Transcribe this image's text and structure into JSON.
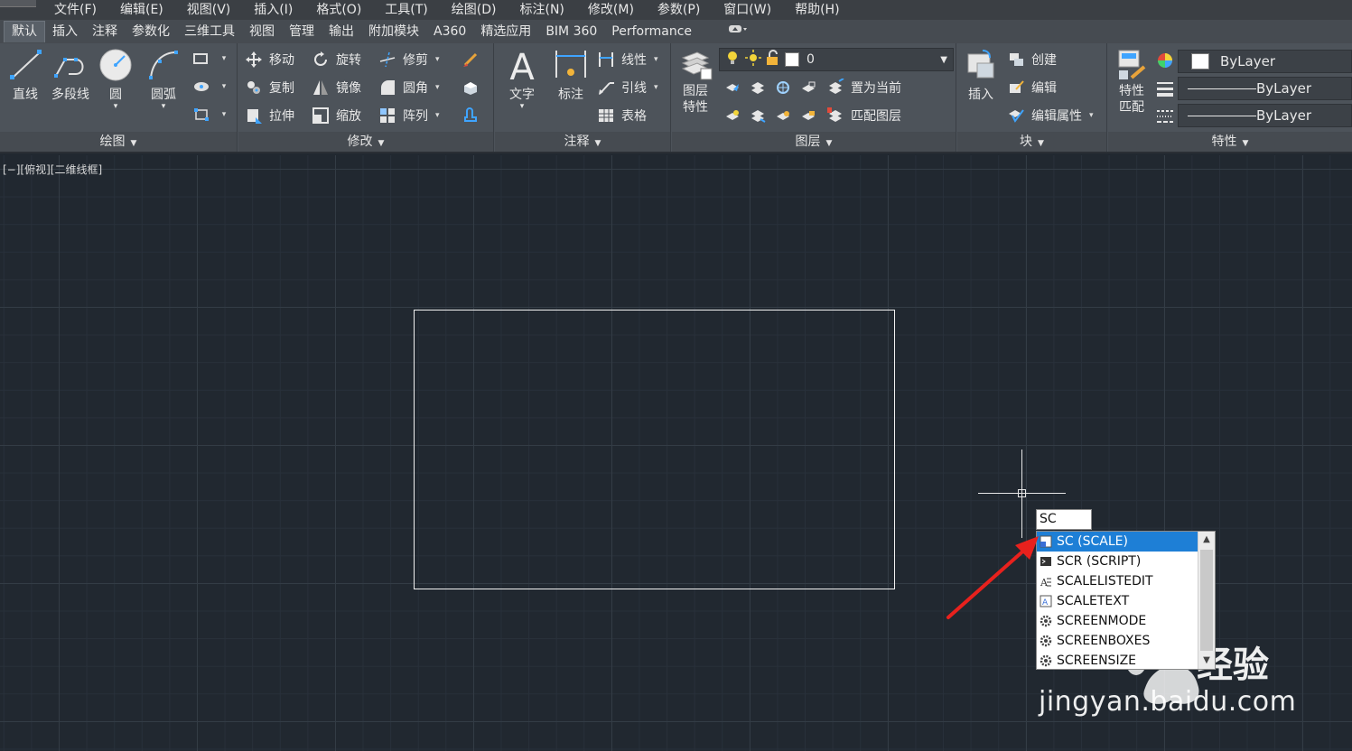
{
  "menu": [
    "文件(F)",
    "编辑(E)",
    "视图(V)",
    "插入(I)",
    "格式(O)",
    "工具(T)",
    "绘图(D)",
    "标注(N)",
    "修改(M)",
    "参数(P)",
    "窗口(W)",
    "帮助(H)"
  ],
  "tabs": [
    "默认",
    "插入",
    "注释",
    "参数化",
    "三维工具",
    "视图",
    "管理",
    "输出",
    "附加模块",
    "A360",
    "精选应用",
    "BIM 360",
    "Performance"
  ],
  "panels": {
    "draw": {
      "title": "绘图",
      "line": "直线",
      "polyline": "多段线",
      "circle": "圆",
      "arc": "圆弧"
    },
    "modify": {
      "title": "修改",
      "move": "移动",
      "rotate": "旋转",
      "trim": "修剪",
      "copy": "复制",
      "mirror": "镜像",
      "fillet": "圆角",
      "stretch": "拉伸",
      "scale": "缩放",
      "array": "阵列"
    },
    "annotation": {
      "title": "注释",
      "text": "文字",
      "dimension": "标注",
      "linear": "线性",
      "leader": "引线",
      "table": "表格"
    },
    "layers": {
      "title": "图层",
      "layer_props_1": "图层",
      "layer_props_2": "特性",
      "current_layer": "0",
      "set_current": "置为当前",
      "match_layer": "匹配图层"
    },
    "block": {
      "title": "块",
      "insert": "插入",
      "create": "创建",
      "edit": "编辑",
      "edit_attr": "编辑属性"
    },
    "properties": {
      "title": "特性",
      "match_1": "特性",
      "match_2": "匹配",
      "color": "ByLayer",
      "linetype": "ByLayer",
      "lineweight": "ByLayer"
    }
  },
  "viewport": {
    "label": "[−][俯视][二维线框]"
  },
  "command": {
    "input_value": "SC",
    "suggestions": [
      {
        "label": "SC (SCALE)",
        "icon": "scale-icon",
        "selected": true
      },
      {
        "label": "SCR (SCRIPT)",
        "icon": "script-icon",
        "selected": false
      },
      {
        "label": "SCALELISTEDIT",
        "icon": "scalelist-icon",
        "selected": false
      },
      {
        "label": "SCALETEXT",
        "icon": "scaletext-icon",
        "selected": false
      },
      {
        "label": "SCREENMODE",
        "icon": "gear-icon",
        "selected": false
      },
      {
        "label": "SCREENBOXES",
        "icon": "gear-icon",
        "selected": false
      },
      {
        "label": "SCREENSIZE",
        "icon": "gear-icon",
        "selected": false
      }
    ]
  },
  "watermark": {
    "brand": "经验",
    "url": "jingyan.baidu.com"
  },
  "colors": {
    "canvas": "#212830",
    "ribbon": "#4d535a",
    "selection": "#1e7fd6",
    "annotation_arrow": "#e8211d"
  }
}
